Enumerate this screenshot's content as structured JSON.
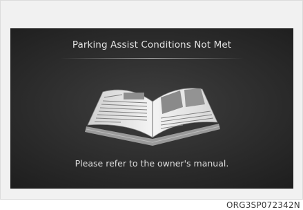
{
  "screen": {
    "title": "Parking Assist Conditions Not Met",
    "message": "Please refer to the owner's manual.",
    "illustration": "open-book-icon"
  },
  "figure_code": "ORG3SP072342N"
}
